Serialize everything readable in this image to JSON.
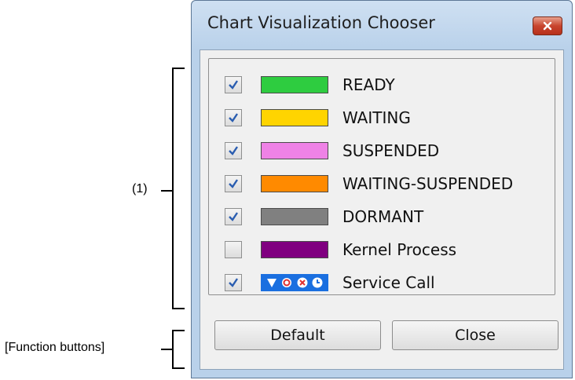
{
  "annotations": {
    "list_callout": "(1)",
    "buttons_callout": "[Function buttons]"
  },
  "window": {
    "title": "Chart Visualization Chooser",
    "close_icon": "close-icon"
  },
  "items": [
    {
      "label": "READY",
      "checked": true,
      "color": "#2ecc40"
    },
    {
      "label": "WAITING",
      "checked": true,
      "color": "#ffd400"
    },
    {
      "label": "SUSPENDED",
      "checked": true,
      "color": "#ef82e6"
    },
    {
      "label": "WAITING-SUSPENDED",
      "checked": true,
      "color": "#ff8a00"
    },
    {
      "label": "DORMANT",
      "checked": true,
      "color": "#808080"
    },
    {
      "label": "Kernel Process",
      "checked": false,
      "color": "#800080"
    },
    {
      "label": "Service Call",
      "checked": true,
      "icons": [
        "triangle-down-icon",
        "circle-icon",
        "x-circle-icon",
        "clock-icon"
      ]
    }
  ],
  "buttons": {
    "default_label": "Default",
    "close_label": "Close"
  },
  "colors": {
    "titlebar": "#b9d1ea",
    "client": "#f0f0f0",
    "close_button": "#c8452e",
    "checkmark": "#2a5db0",
    "service_call_bg": "#1a6fe0"
  }
}
